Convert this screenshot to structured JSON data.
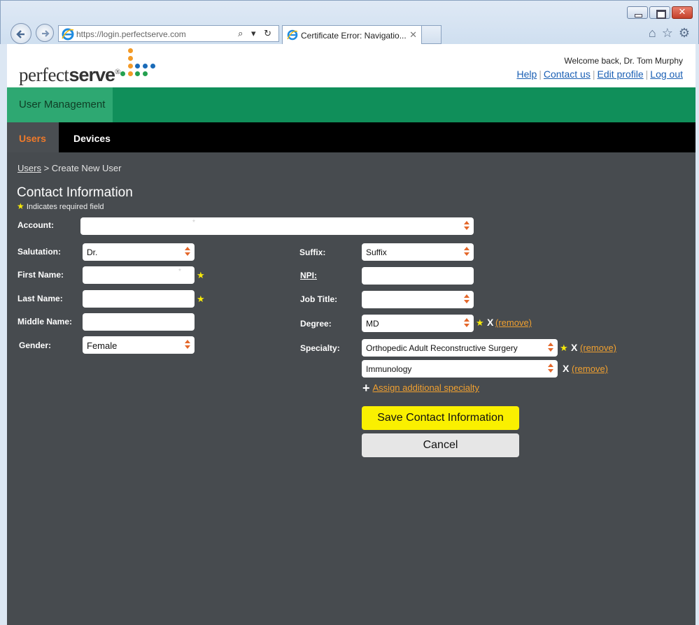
{
  "browser": {
    "url": "https://login.perfectserve.com",
    "tab_title": "Certificate Error: Navigatio...",
    "address_tools": "⌕ ▾ ↻"
  },
  "header": {
    "logo_light": "perfect",
    "logo_bold": "serve",
    "logo_mark": "®",
    "welcome": "Welcome back, Dr. Tom Murphy",
    "links": {
      "help": "Help",
      "contact": "Contact us",
      "edit_profile": "Edit profile",
      "logout": "Log out"
    }
  },
  "nav": {
    "section": "User Management",
    "tabs": {
      "users": "Users",
      "devices": "Devices"
    }
  },
  "breadcrumb": {
    "link": "Users",
    "sep": ">",
    "current": "Create New User"
  },
  "form": {
    "title": "Contact Information",
    "required_note": "Indicates required field",
    "required_star": "★",
    "account": {
      "label": "Account:",
      "value": ""
    },
    "salutation": {
      "label": "Salutation:",
      "value": "Dr."
    },
    "first_name": {
      "label": "First Name:",
      "value": ""
    },
    "last_name": {
      "label": "Last Name:",
      "value": ""
    },
    "middle_name": {
      "label": "Middle Name:",
      "value": ""
    },
    "gender": {
      "label": "Gender:",
      "value": "Female"
    },
    "suffix": {
      "label": "Suffix:",
      "value": "Suffix"
    },
    "npi": {
      "label": "NPI:",
      "value": ""
    },
    "job_title": {
      "label": "Job Title:",
      "value": ""
    },
    "degree": {
      "label": "Degree:",
      "value": "MD",
      "remove": "(remove)",
      "x": "X"
    },
    "specialty": {
      "label": "Specialty:",
      "items": [
        {
          "value": "Orthopedic Adult Reconstructive Surgery",
          "remove": "(remove)",
          "x": "X"
        },
        {
          "value": "Immunology",
          "remove": "(remove)",
          "x": "X"
        }
      ],
      "add": "Assign additional specialty",
      "add_symbol": "+"
    },
    "save_button": "Save Contact Information",
    "cancel_button": "Cancel"
  },
  "colors": {
    "green": "#108f5a",
    "green_light": "#2ea872",
    "accent_orange": "#f07a2a",
    "save_yellow": "#faf000",
    "panel": "#474b4f"
  }
}
